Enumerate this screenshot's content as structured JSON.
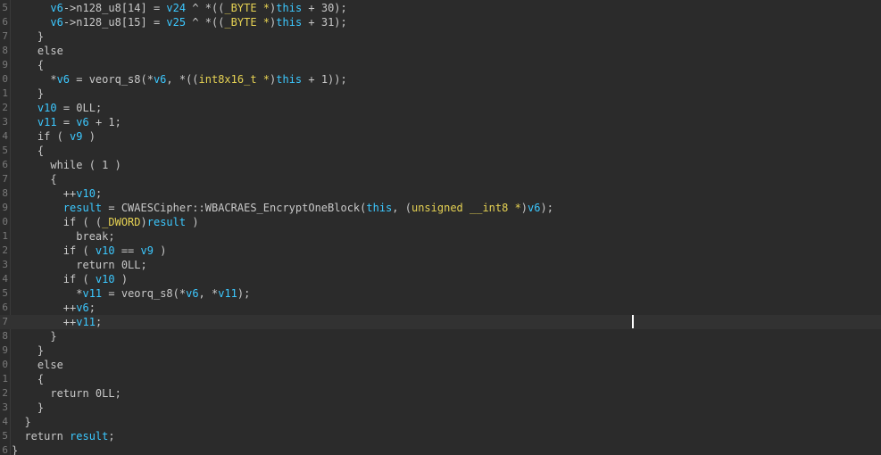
{
  "editor": {
    "first_line_number": 5,
    "current_line_index": 22,
    "lines": [
      {
        "ln": "5",
        "tokens": [
          {
            "t": "      ",
            "c": "default"
          },
          {
            "t": "v6",
            "c": "var"
          },
          {
            "t": "->n128_u8[14] = ",
            "c": "default"
          },
          {
            "t": "v24",
            "c": "var"
          },
          {
            "t": " ^ *((",
            "c": "default"
          },
          {
            "t": "_BYTE *",
            "c": "type"
          },
          {
            "t": ")",
            "c": "default"
          },
          {
            "t": "this",
            "c": "var"
          },
          {
            "t": " + 30);",
            "c": "default"
          }
        ]
      },
      {
        "ln": "6",
        "tokens": [
          {
            "t": "      ",
            "c": "default"
          },
          {
            "t": "v6",
            "c": "var"
          },
          {
            "t": "->n128_u8[15] = ",
            "c": "default"
          },
          {
            "t": "v25",
            "c": "var"
          },
          {
            "t": " ^ *((",
            "c": "default"
          },
          {
            "t": "_BYTE *",
            "c": "type"
          },
          {
            "t": ")",
            "c": "default"
          },
          {
            "t": "this",
            "c": "var"
          },
          {
            "t": " + 31);",
            "c": "default"
          }
        ]
      },
      {
        "ln": "7",
        "tokens": [
          {
            "t": "    }",
            "c": "default"
          }
        ]
      },
      {
        "ln": "8",
        "tokens": [
          {
            "t": "    else",
            "c": "default"
          }
        ]
      },
      {
        "ln": "9",
        "tokens": [
          {
            "t": "    {",
            "c": "default"
          }
        ]
      },
      {
        "ln": "0",
        "tokens": [
          {
            "t": "      *",
            "c": "default"
          },
          {
            "t": "v6",
            "c": "var"
          },
          {
            "t": " = veorq_s8(*",
            "c": "default"
          },
          {
            "t": "v6",
            "c": "var"
          },
          {
            "t": ", *((",
            "c": "default"
          },
          {
            "t": "int8x16_t *",
            "c": "type"
          },
          {
            "t": ")",
            "c": "default"
          },
          {
            "t": "this",
            "c": "var"
          },
          {
            "t": " + 1));",
            "c": "default"
          }
        ]
      },
      {
        "ln": "1",
        "tokens": [
          {
            "t": "    }",
            "c": "default"
          }
        ]
      },
      {
        "ln": "2",
        "tokens": [
          {
            "t": "    ",
            "c": "default"
          },
          {
            "t": "v10",
            "c": "var"
          },
          {
            "t": " = 0LL;",
            "c": "default"
          }
        ]
      },
      {
        "ln": "3",
        "tokens": [
          {
            "t": "    ",
            "c": "default"
          },
          {
            "t": "v11",
            "c": "var"
          },
          {
            "t": " = ",
            "c": "default"
          },
          {
            "t": "v6",
            "c": "var"
          },
          {
            "t": " + 1;",
            "c": "default"
          }
        ]
      },
      {
        "ln": "4",
        "tokens": [
          {
            "t": "    if ( ",
            "c": "default"
          },
          {
            "t": "v9",
            "c": "var"
          },
          {
            "t": " )",
            "c": "default"
          }
        ]
      },
      {
        "ln": "5",
        "tokens": [
          {
            "t": "    {",
            "c": "default"
          }
        ]
      },
      {
        "ln": "6",
        "tokens": [
          {
            "t": "      while ( 1 )",
            "c": "default"
          }
        ]
      },
      {
        "ln": "7",
        "tokens": [
          {
            "t": "      {",
            "c": "default"
          }
        ]
      },
      {
        "ln": "8",
        "tokens": [
          {
            "t": "        ++",
            "c": "default"
          },
          {
            "t": "v10",
            "c": "var"
          },
          {
            "t": ";",
            "c": "default"
          }
        ]
      },
      {
        "ln": "9",
        "tokens": [
          {
            "t": "        ",
            "c": "default"
          },
          {
            "t": "result",
            "c": "var"
          },
          {
            "t": " = CWAESCipher::WBACRAES_EncryptOneBlock(",
            "c": "default"
          },
          {
            "t": "this",
            "c": "var"
          },
          {
            "t": ", (",
            "c": "default"
          },
          {
            "t": "unsigned __int8 *",
            "c": "type"
          },
          {
            "t": ")",
            "c": "default"
          },
          {
            "t": "v6",
            "c": "var"
          },
          {
            "t": ");",
            "c": "default"
          }
        ]
      },
      {
        "ln": "0",
        "tokens": [
          {
            "t": "        if ( (",
            "c": "default"
          },
          {
            "t": "_DWORD",
            "c": "type"
          },
          {
            "t": ")",
            "c": "default"
          },
          {
            "t": "result",
            "c": "var"
          },
          {
            "t": " )",
            "c": "default"
          }
        ]
      },
      {
        "ln": "1",
        "tokens": [
          {
            "t": "          break;",
            "c": "default"
          }
        ]
      },
      {
        "ln": "2",
        "tokens": [
          {
            "t": "        if ( ",
            "c": "default"
          },
          {
            "t": "v10",
            "c": "var"
          },
          {
            "t": " == ",
            "c": "default"
          },
          {
            "t": "v9",
            "c": "var"
          },
          {
            "t": " )",
            "c": "default"
          }
        ]
      },
      {
        "ln": "3",
        "tokens": [
          {
            "t": "          return 0LL;",
            "c": "default"
          }
        ]
      },
      {
        "ln": "4",
        "tokens": [
          {
            "t": "        if ( ",
            "c": "default"
          },
          {
            "t": "v10",
            "c": "var"
          },
          {
            "t": " )",
            "c": "default"
          }
        ]
      },
      {
        "ln": "5",
        "tokens": [
          {
            "t": "          *",
            "c": "default"
          },
          {
            "t": "v11",
            "c": "var"
          },
          {
            "t": " = veorq_s8(*",
            "c": "default"
          },
          {
            "t": "v6",
            "c": "var"
          },
          {
            "t": ", *",
            "c": "default"
          },
          {
            "t": "v11",
            "c": "var"
          },
          {
            "t": ");",
            "c": "default"
          }
        ]
      },
      {
        "ln": "6",
        "tokens": [
          {
            "t": "        ++",
            "c": "default"
          },
          {
            "t": "v6",
            "c": "var"
          },
          {
            "t": ";",
            "c": "default"
          }
        ]
      },
      {
        "ln": "7",
        "tokens": [
          {
            "t": "        ++",
            "c": "default"
          },
          {
            "t": "v11",
            "c": "var"
          },
          {
            "t": ";",
            "c": "default"
          }
        ]
      },
      {
        "ln": "8",
        "tokens": [
          {
            "t": "      }",
            "c": "default"
          }
        ]
      },
      {
        "ln": "9",
        "tokens": [
          {
            "t": "    }",
            "c": "default"
          }
        ]
      },
      {
        "ln": "0",
        "tokens": [
          {
            "t": "    else",
            "c": "default"
          }
        ]
      },
      {
        "ln": "1",
        "tokens": [
          {
            "t": "    {",
            "c": "default"
          }
        ]
      },
      {
        "ln": "2",
        "tokens": [
          {
            "t": "      return 0LL;",
            "c": "default"
          }
        ]
      },
      {
        "ln": "3",
        "tokens": [
          {
            "t": "    }",
            "c": "default"
          }
        ]
      },
      {
        "ln": "4",
        "tokens": [
          {
            "t": "  }",
            "c": "default"
          }
        ]
      },
      {
        "ln": "5",
        "tokens": [
          {
            "t": "  return ",
            "c": "default"
          },
          {
            "t": "result",
            "c": "var"
          },
          {
            "t": ";",
            "c": "default"
          }
        ]
      },
      {
        "ln": "6",
        "tokens": [
          {
            "t": "}",
            "c": "default"
          }
        ]
      }
    ]
  },
  "colors": {
    "background": "#2b2b2b",
    "current_line": "#323232",
    "default_text": "#c8c8c8",
    "identifier": "#3cc8ff",
    "type_cast": "#e6d253",
    "line_number": "#7a7a7a",
    "caret": "#ffffff"
  }
}
